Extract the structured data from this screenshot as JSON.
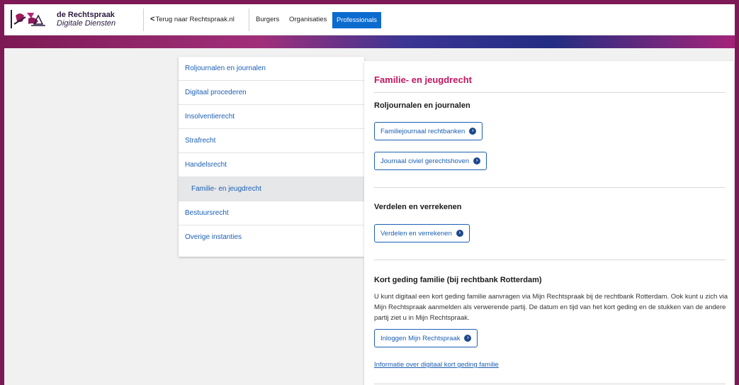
{
  "header": {
    "brand_name": "de Rechtspraak",
    "brand_sub": "Digitale Diensten",
    "back_link": "Terug naar Rechtspraak.nl",
    "nav": [
      "Burgers",
      "Organisaties",
      "Professionals"
    ],
    "active_nav": "Professionals"
  },
  "sidebar": {
    "items": [
      {
        "label": "Roljournalen en journalen"
      },
      {
        "label": "Digitaal procederen"
      },
      {
        "label": "Insolventierecht"
      },
      {
        "label": "Strafrecht"
      },
      {
        "label": "Handelsrecht"
      },
      {
        "label": "Familie- en jeugdrecht",
        "active": true
      },
      {
        "label": "Bestuursrecht"
      },
      {
        "label": "Overige instanties"
      }
    ]
  },
  "main": {
    "title": "Familie- en jeugdrecht",
    "sections": [
      {
        "title": "Roljournalen en journalen",
        "buttons": [
          "Familiejournaal rechtbanken",
          "Journaal civiel gerechtshoven"
        ]
      },
      {
        "title": "Verdelen en verrekenen",
        "buttons": [
          "Verdelen en verrekenen"
        ]
      },
      {
        "title": "Kort geding familie (bij rechtbank Rotterdam)",
        "text": "U kunt digitaal een kort geding familie aanvragen via Mijn Rechtspraak bij de rechtbank Rotterdam. Ook kunt u zich via Mijn Rechtspraak aanmelden als verwerende partij. De datum en tijd van het kort geding en de stukken van de andere partij ziet u in Mijn Rechtspraak.",
        "buttons": [
          "Inloggen Mijn Rechtspraak"
        ],
        "link": "Informatie over digitaal kort geding familie"
      }
    ]
  },
  "colors": {
    "frame": "#7d1a55",
    "accent_blue": "#0c6bcf",
    "title_magenta": "#c1175f",
    "link_blue": "#1c5fb3"
  }
}
